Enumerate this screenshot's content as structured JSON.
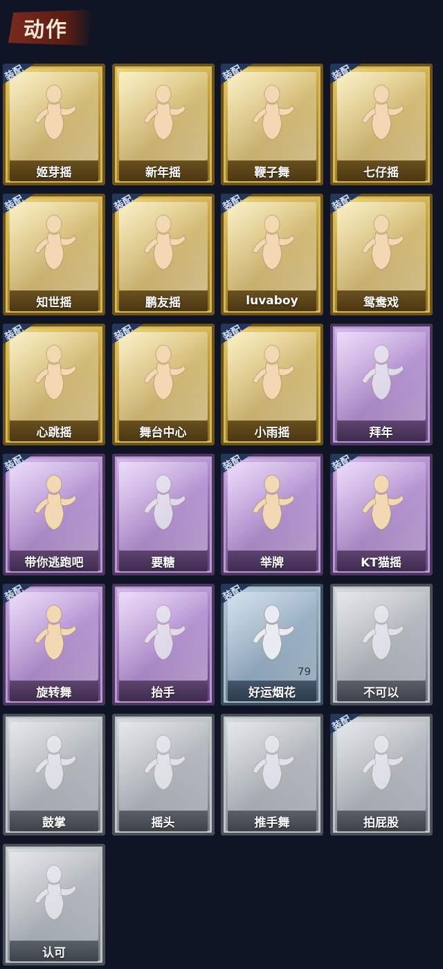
{
  "header": {
    "title": "动作"
  },
  "equip_label": "装配",
  "colors": {
    "gold": "#c8a640",
    "purple": "#a47bc2",
    "blue": "#8ea6b9",
    "gray": "#aeb3b9",
    "figure_gold": "#f3d9b3",
    "figure_silver": "#e9ecf2"
  },
  "actions": [
    {
      "name": "姬芽摇",
      "rarity": "gold",
      "equipped": true
    },
    {
      "name": "新年摇",
      "rarity": "gold",
      "equipped": false
    },
    {
      "name": "鞭子舞",
      "rarity": "gold",
      "equipped": true
    },
    {
      "name": "七仔摇",
      "rarity": "gold",
      "equipped": true
    },
    {
      "name": "知世摇",
      "rarity": "gold",
      "equipped": true
    },
    {
      "name": "鹏友摇",
      "rarity": "gold",
      "equipped": true
    },
    {
      "name": "luvaboy",
      "rarity": "gold",
      "equipped": true
    },
    {
      "name": "鸳鸯戏",
      "rarity": "gold",
      "equipped": true
    },
    {
      "name": "心跳摇",
      "rarity": "gold",
      "equipped": true
    },
    {
      "name": "舞台中心",
      "rarity": "gold",
      "equipped": true
    },
    {
      "name": "小雨摇",
      "rarity": "gold",
      "equipped": true
    },
    {
      "name": "拜年",
      "rarity": "purple",
      "equipped": false
    },
    {
      "name": "带你逃跑吧",
      "rarity": "purple",
      "equipped": true
    },
    {
      "name": "要糖",
      "rarity": "purple",
      "equipped": false
    },
    {
      "name": "举牌",
      "rarity": "purple",
      "equipped": true
    },
    {
      "name": "KT猫摇",
      "rarity": "purple",
      "equipped": true
    },
    {
      "name": "旋转舞",
      "rarity": "purple",
      "equipped": true
    },
    {
      "name": "抬手",
      "rarity": "purple",
      "equipped": false
    },
    {
      "name": "好运烟花",
      "rarity": "blue",
      "equipped": true,
      "count": "79"
    },
    {
      "name": "不可以",
      "rarity": "gray",
      "equipped": false
    },
    {
      "name": "鼓掌",
      "rarity": "gray",
      "equipped": false
    },
    {
      "name": "摇头",
      "rarity": "gray",
      "equipped": false
    },
    {
      "name": "推手舞",
      "rarity": "gray",
      "equipped": false
    },
    {
      "name": "拍屁股",
      "rarity": "gray",
      "equipped": true
    },
    {
      "name": "认可",
      "rarity": "gray",
      "equipped": false
    }
  ]
}
